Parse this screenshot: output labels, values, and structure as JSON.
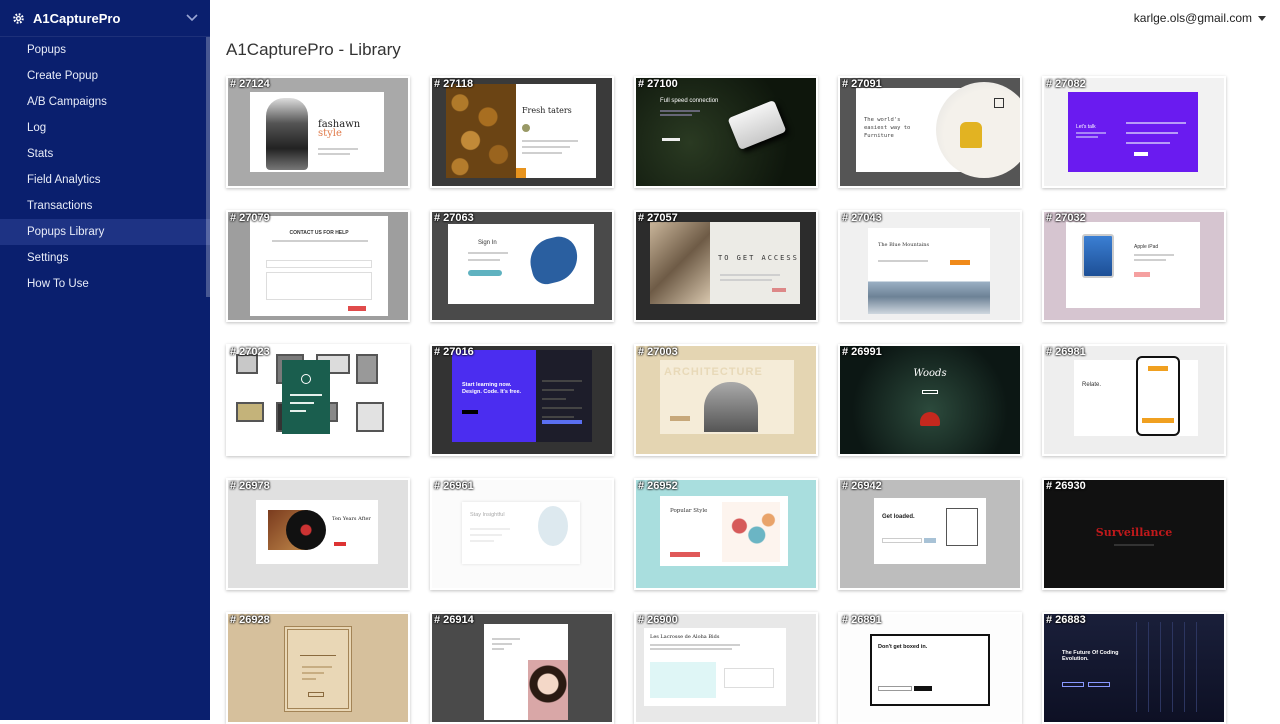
{
  "app": {
    "name": "A1CapturePro"
  },
  "account": {
    "email": "karlge.ols@gmail.com"
  },
  "page": {
    "title": "A1CapturePro - Library"
  },
  "sidebar": {
    "items": [
      {
        "label": "Popups",
        "active": false
      },
      {
        "label": "Create Popup",
        "active": false
      },
      {
        "label": "A/B Campaigns",
        "active": false
      },
      {
        "label": "Log",
        "active": false
      },
      {
        "label": "Stats",
        "active": false
      },
      {
        "label": "Field Analytics",
        "active": false
      },
      {
        "label": "Transactions",
        "active": false
      },
      {
        "label": "Popups Library",
        "active": true
      },
      {
        "label": "Settings",
        "active": false
      },
      {
        "label": "How To Use",
        "active": false
      }
    ]
  },
  "colors": {
    "sidebar": "#0a1f6e",
    "sidebar_active": "#1e3384",
    "accent_purple": "#6a1bf0",
    "accent_orange": "#e88a1a"
  },
  "library": {
    "cards": [
      {
        "id": "# 27124",
        "text": "fashawn style",
        "style": "fashion"
      },
      {
        "id": "# 27118",
        "text": "Fresh taters",
        "style": "taters"
      },
      {
        "id": "# 27100",
        "text": "Full speed connection",
        "style": "router"
      },
      {
        "id": "# 27091",
        "text": "The world's easiest way to Furniture",
        "style": "chair"
      },
      {
        "id": "# 27082",
        "text": "Let's talk",
        "style": "purple"
      },
      {
        "id": "# 27079",
        "text": "CONTACT US FOR HELP",
        "style": "contact"
      },
      {
        "id": "# 27063",
        "text": "Sign In",
        "style": "signin"
      },
      {
        "id": "# 27057",
        "text": "TO GET ACCESS",
        "style": "access"
      },
      {
        "id": "# 27043",
        "text": "The Blue Mountains",
        "style": "mountains"
      },
      {
        "id": "# 27032",
        "text": "Apple iPad",
        "style": "ipad"
      },
      {
        "id": "# 27023",
        "text": "",
        "style": "frames"
      },
      {
        "id": "# 27016",
        "text": "Start learning now. Design. Code. It's free.",
        "style": "learn"
      },
      {
        "id": "# 27003",
        "text": "ARCHITECTURE",
        "style": "architecture"
      },
      {
        "id": "# 26991",
        "text": "Woods",
        "style": "woods"
      },
      {
        "id": "# 26981",
        "text": "Relate.",
        "style": "relate"
      },
      {
        "id": "# 26978",
        "text": "Ten Years After",
        "style": "vinyl"
      },
      {
        "id": "# 26961",
        "text": "Stay Insightful",
        "style": "insight"
      },
      {
        "id": "# 26952",
        "text": "Popular Style",
        "style": "popular"
      },
      {
        "id": "# 26942",
        "text": "Get loaded.",
        "style": "loaded"
      },
      {
        "id": "# 26930",
        "text": "Surveillance",
        "style": "surveillance"
      },
      {
        "id": "# 26928",
        "text": "",
        "style": "ornate"
      },
      {
        "id": "# 26914",
        "text": "",
        "style": "portrait"
      },
      {
        "id": "# 26900",
        "text": "Les Lacrosse de Aloha Bids",
        "style": "lacrosse"
      },
      {
        "id": "# 26891",
        "text": "Don't get boxed in.",
        "style": "boxed"
      },
      {
        "id": "# 26883",
        "text": "The Future Of Coding Evolution.",
        "style": "coding"
      }
    ]
  }
}
